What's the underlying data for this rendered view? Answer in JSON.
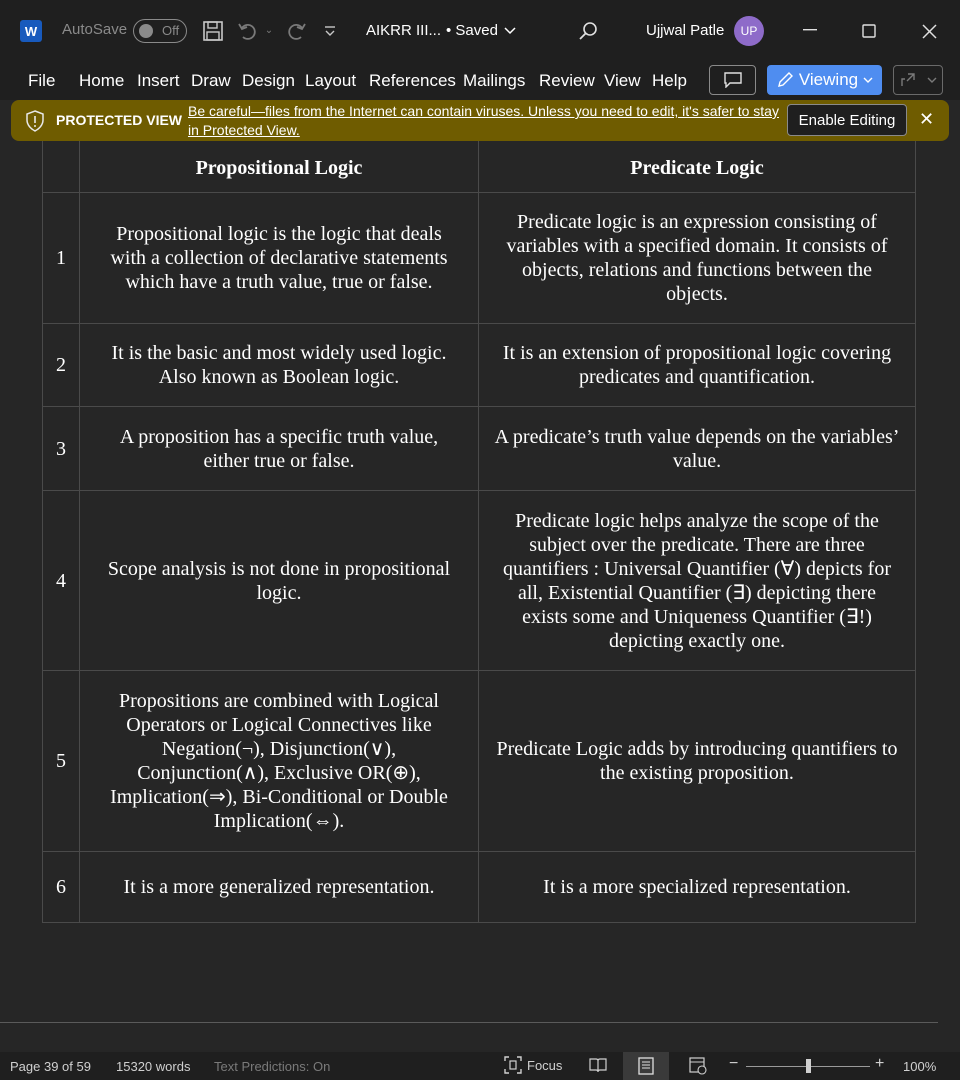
{
  "titlebar": {
    "app_icon": "W",
    "autosave_label": "AutoSave",
    "autosave_state": "Off",
    "doc_title": "AIKRR III...",
    "saved_status": "• Saved",
    "user_name": "Ujjwal Patle",
    "user_initials": "UP"
  },
  "ribbon": {
    "tabs": [
      "File",
      "Home",
      "Insert",
      "Draw",
      "Design",
      "Layout",
      "References",
      "Mailings",
      "Review",
      "View",
      "Help"
    ],
    "viewing_label": "Viewing"
  },
  "protected_view": {
    "title": "PROTECTED VIEW",
    "message": "Be careful—files from the Internet can contain viruses. Unless you need to edit, it's safer to stay in Protected View.",
    "enable_button": "Enable Editing"
  },
  "table": {
    "headers": [
      "",
      "Propositional Logic",
      "Predicate Logic"
    ],
    "rows": [
      {
        "num": "1",
        "prop": "Propositional logic is the logic that deals with a collection of declarative statements which have a truth value, true or false.",
        "pred": "Predicate logic is an expression consisting of variables with a specified domain. It consists of objects, relations and functions between the objects."
      },
      {
        "num": "2",
        "prop": "It is the basic and most widely used logic. Also known as Boolean logic.",
        "pred": "It is an extension of propositional logic covering predicates and quantification."
      },
      {
        "num": "3",
        "prop": "A proposition has a specific truth value, either true or false.",
        "pred": "A predicate’s truth value depends on the variables’ value."
      },
      {
        "num": "4",
        "prop": "Scope analysis is not done in propositional logic.",
        "pred": "Predicate logic helps analyze the scope of the subject over the predicate. There are three quantifiers : Universal Quantifier (∀) depicts for all, Existential Quantifier (∃) depicting there exists some and Uniqueness Quantifier (∃!) depicting exactly one."
      },
      {
        "num": "5",
        "prop": "Propositions are combined with Logical Operators or Logical Connectives like Negation(¬), Disjunction(∨), Conjunction(∧), Exclusive OR(⊕), Implication(⇒), Bi-Conditional or Double Implication(⇔).",
        "pred": "Predicate Logic adds by introducing quantifiers to the existing proposition."
      },
      {
        "num": "6",
        "prop": "It is a more generalized representation.",
        "pred": "It is a more specialized representation."
      }
    ]
  },
  "statusbar": {
    "page": "Page 39 of 59",
    "words": "15320 words",
    "predictions": "Text Predictions: On",
    "focus": "Focus",
    "zoom": "100%"
  },
  "colors": {
    "accent": "#4f8df0",
    "protected_bar": "#6f5c00",
    "background": "#262626"
  }
}
